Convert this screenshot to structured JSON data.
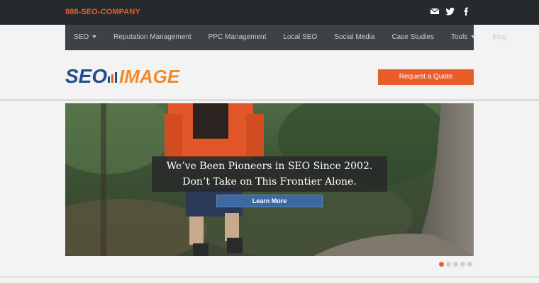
{
  "topbar": {
    "phone": "888-SEO-COMPANY",
    "icons": [
      "email-icon",
      "twitter-icon",
      "facebook-icon"
    ]
  },
  "nav": {
    "items": [
      {
        "label": "SEO",
        "dropdown": true
      },
      {
        "label": "Reputation Management",
        "dropdown": false
      },
      {
        "label": "PPC Management",
        "dropdown": false
      },
      {
        "label": "Local SEO",
        "dropdown": false
      },
      {
        "label": "Social Media",
        "dropdown": false
      },
      {
        "label": "Case Studies",
        "dropdown": false
      },
      {
        "label": "Tools",
        "dropdown": true
      },
      {
        "label": "Blog",
        "dropdown": false
      }
    ]
  },
  "header": {
    "logo_text_1": "SEO",
    "logo_text_2": "IMAGE",
    "quote_button": "Request a Quote"
  },
  "hero": {
    "line1": "We’ve Been Pioneers in SEO Since 2002.",
    "line2": "Don’t Take on This Frontier Alone.",
    "cta": "Learn More"
  },
  "slider": {
    "count": 5,
    "active_index": 0
  },
  "colors": {
    "accent": "#e95d2b",
    "topbar": "#252a2d",
    "nav": "#3d4246",
    "button_blue": "#3c6aa0"
  }
}
